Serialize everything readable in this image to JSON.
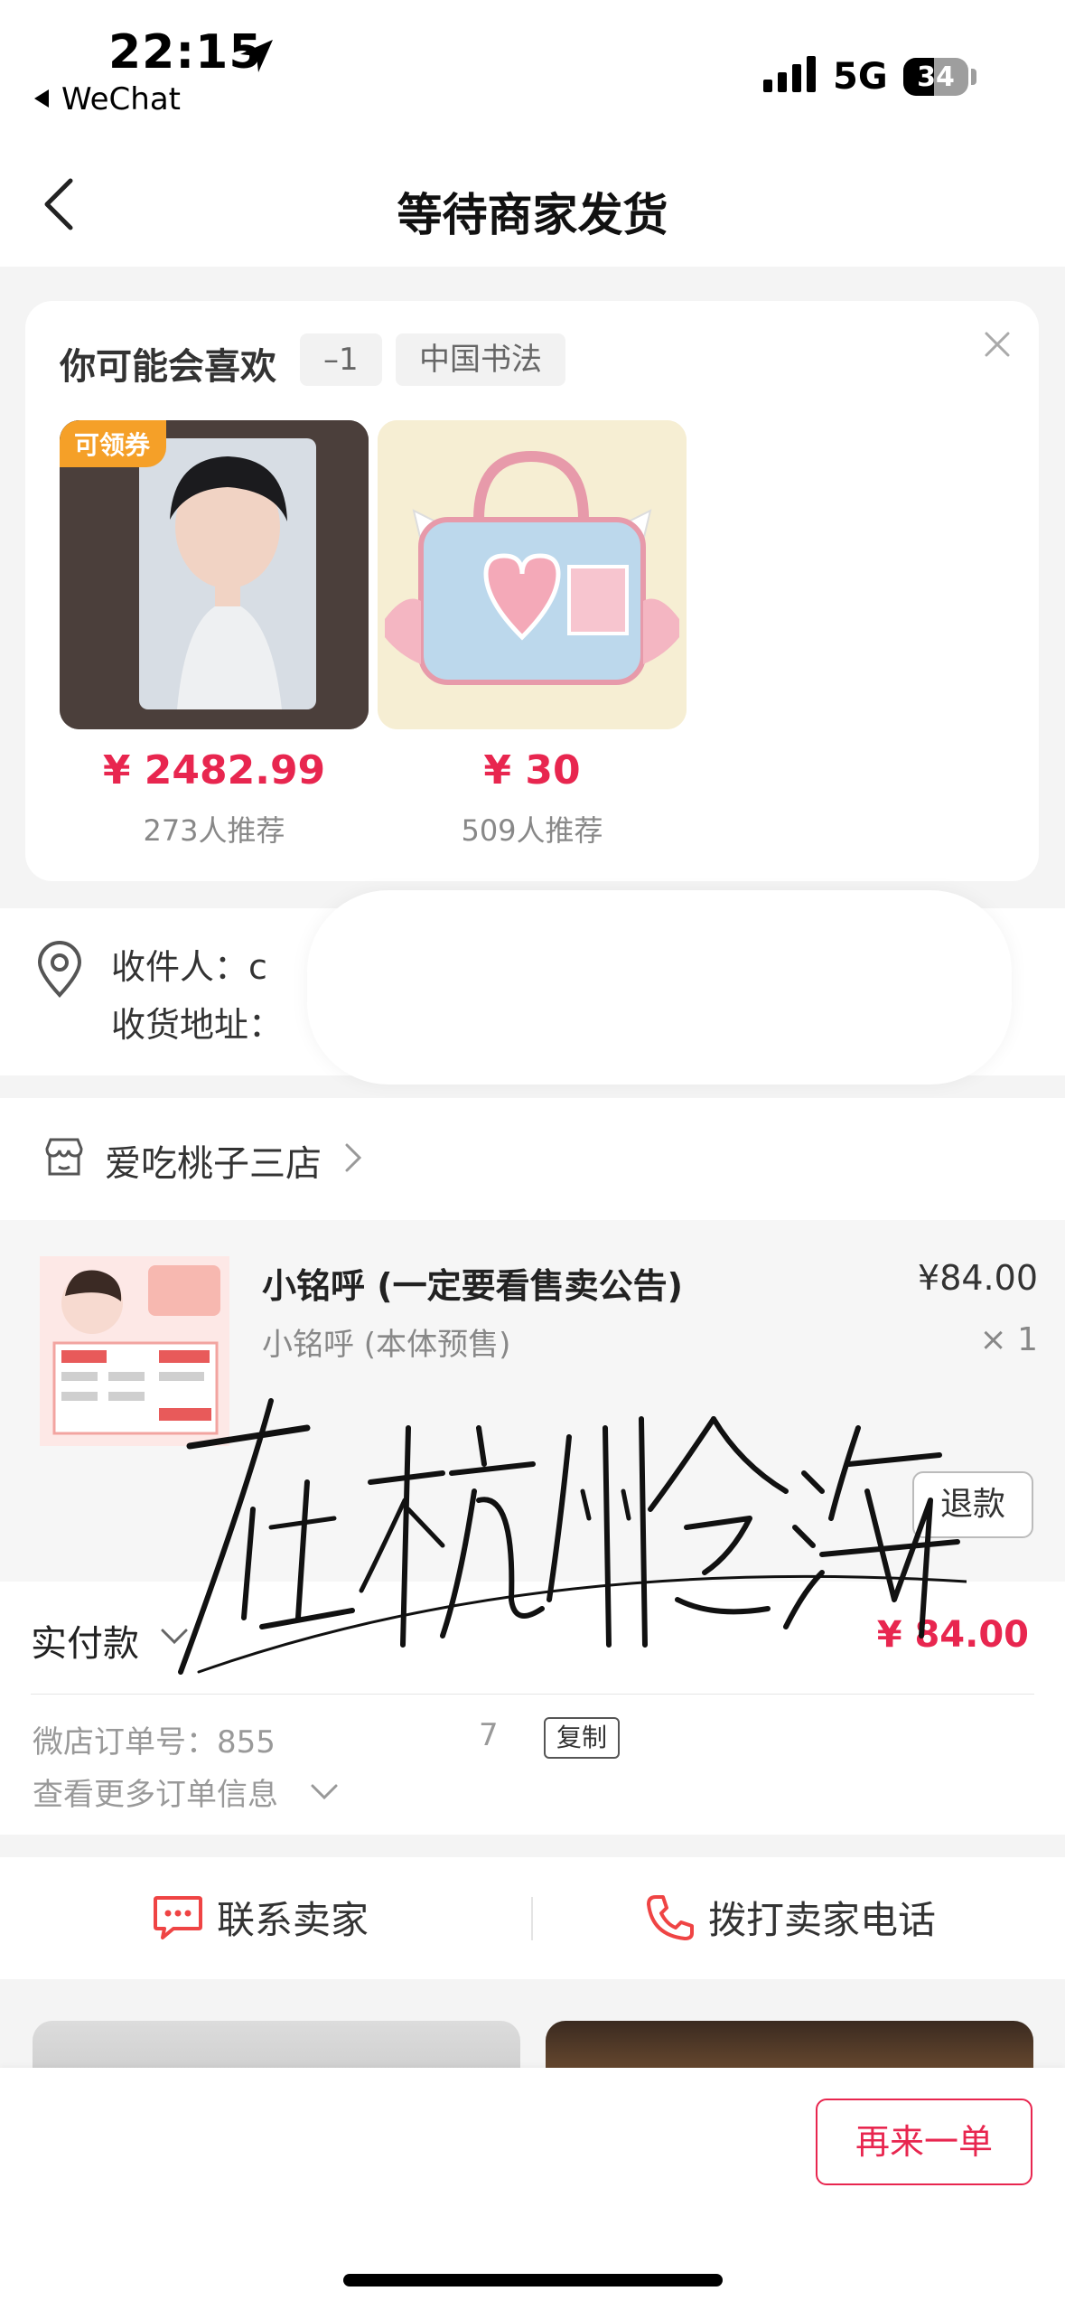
{
  "status_bar": {
    "time": "22:15",
    "back_app": "WeChat",
    "network": "5G",
    "battery": "34"
  },
  "nav": {
    "title": "等待商家发货"
  },
  "recommend": {
    "title": "你可能会喜欢",
    "chips": [
      "–1",
      "中国书法"
    ],
    "products": [
      {
        "badge": "可领券",
        "price": "¥ 2482.99",
        "recommend_count": "273人推荐"
      },
      {
        "badge": "",
        "price": "¥ 30",
        "recommend_count": "509人推荐"
      }
    ]
  },
  "address": {
    "recipient_line": "收件人：c",
    "address_line": "收货地址："
  },
  "shop": {
    "name": "爱吃桃子三店"
  },
  "item": {
    "title": "小铭呼 (一定要看售卖公告)",
    "spec": "小铭呼 (本体预售)",
    "price": "¥84.00",
    "qty": "× 1",
    "refund_label": "退款"
  },
  "payment": {
    "label": "实付款",
    "amount": "¥ 84.00",
    "order_no": "微店订单号：855",
    "order_tail": "7",
    "copy_label": "复制",
    "more_info": "查看更多订单信息"
  },
  "signature": {
    "text": "在杭州念海"
  },
  "contact": {
    "seller": "联系卖家",
    "phone": "拨打卖家电话"
  },
  "bottom": {
    "again_label": "再来一单"
  },
  "colors": {
    "accent": "#e8264f",
    "coupon": "#f5a028"
  }
}
